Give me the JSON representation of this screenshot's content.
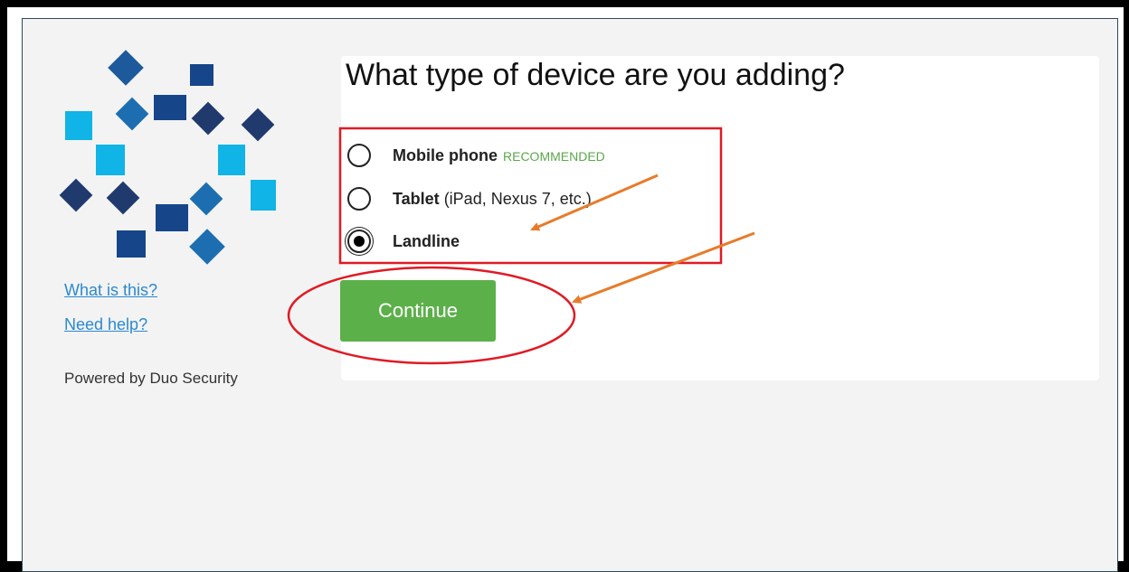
{
  "sidebar": {
    "what_is_this": "What is this?",
    "need_help": "Need help?",
    "powered_by": "Powered by Duo Security"
  },
  "form": {
    "title": "What type of device are you adding?",
    "options": [
      {
        "label": "Mobile phone",
        "note": "RECOMMENDED",
        "checked": false
      },
      {
        "label": "Tablet",
        "note": "(iPad, Nexus 7, etc.)",
        "checked": false
      },
      {
        "label": "Landline",
        "note": "",
        "checked": true
      }
    ],
    "continue_label": "Continue"
  },
  "colors": {
    "accent_green": "#5cb04a",
    "link_blue": "#2a8ad1",
    "annotation_red": "#e01b24",
    "annotation_orange": "#e87b2a"
  }
}
